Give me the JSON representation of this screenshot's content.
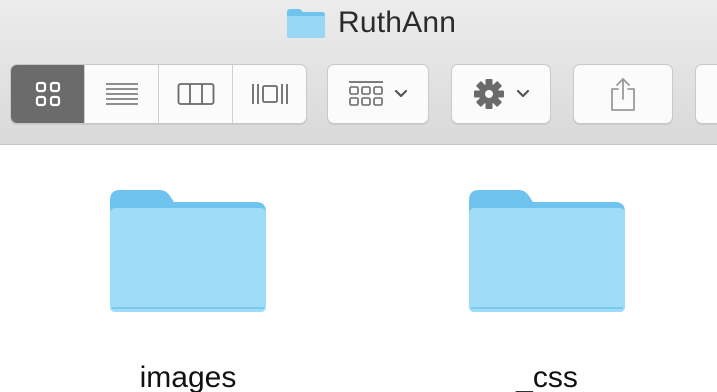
{
  "window": {
    "title": "RuthAnn",
    "title_icon": "folder-icon"
  },
  "toolbar": {
    "view_modes": [
      {
        "name": "icon-view",
        "icon": "icon-grid-icon",
        "active": true
      },
      {
        "name": "list-view",
        "icon": "list-lines-icon",
        "active": false
      },
      {
        "name": "column-view",
        "icon": "columns-icon",
        "active": false
      },
      {
        "name": "cover-flow-view",
        "icon": "cover-flow-icon",
        "active": false
      }
    ],
    "arrange_icon": "arrange-grid-icon",
    "action_icon": "gear-icon",
    "share_icon": "share-icon",
    "dropdown_icon": "chevron-down-icon"
  },
  "items": [
    {
      "name": "images",
      "icon": "folder-icon"
    },
    {
      "name": "_css",
      "icon": "folder-icon"
    }
  ],
  "colors": {
    "folder_light": "#9fdcf8",
    "folder_dark": "#6ec4ee",
    "toolbar_bg": "#e4e4e4",
    "active_segment": "#6b6b6b"
  }
}
